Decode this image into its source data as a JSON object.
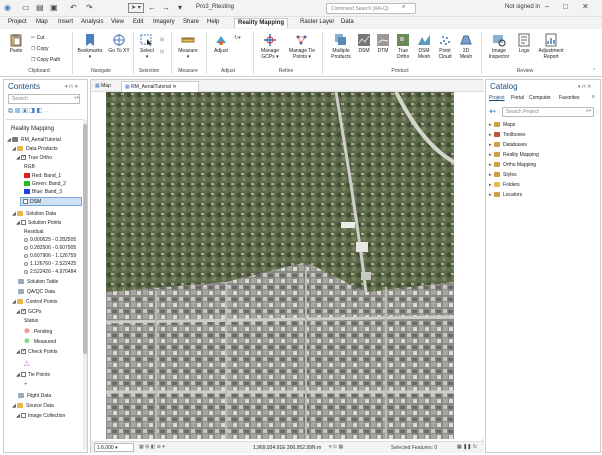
{
  "titlebar": {
    "doc_title": "Pro3_Rtesting",
    "search_placeholder": "Command Search (Alt+Q)",
    "signin": "Not signed in"
  },
  "tabs": {
    "project": "Project",
    "map": "Map",
    "insert": "Insert",
    "analysis": "Analysis",
    "view": "View",
    "edit": "Edit",
    "imagery": "Imagery",
    "share": "Share",
    "help": "Help",
    "reality": "Reality Mapping",
    "raster": "Raster Layer",
    "data": "Data"
  },
  "ribbon": {
    "paste": "Paste",
    "cut": "Cut",
    "copy": "Copy",
    "copy_path": "Copy Path",
    "clipboard": "Clipboard",
    "bookmarks": "Bookmarks",
    "goto": "Go To XY",
    "navigate": "Navigate",
    "select": "Select",
    "selection": "Selection",
    "measure": "Measure",
    "measure_grp": "Measure",
    "adjust": "Adjust",
    "adjust_grp": "Adjust",
    "manage_gcps": "Manage GCPs",
    "manage_tie": "Manage Tie Points",
    "refine": "Refine",
    "multiple": "Multiple Products",
    "dsm": "DSM",
    "dtm": "DTM",
    "true_ortho": "True Ortho",
    "dsm_mesh": "DSM Mesh",
    "point_cloud": "Point Cloud",
    "mesh3d": "3D Mesh",
    "product": "Product",
    "image_inspector": "Image Inspector",
    "logs": "Logs",
    "adj_report": "Adjustment Report",
    "review": "Review"
  },
  "contents": {
    "title": "Contents",
    "search_placeholder": "Search",
    "section": "Reality Mapping",
    "rm": "RM_AerialTutorial",
    "data_products": "Data Products",
    "true_ortho": "True Ortho",
    "rgb": "RGB",
    "red": "Red: Band_1",
    "green": "Green: Band_2",
    "blue": "Blue: Band_3",
    "dsm": "DSM",
    "solution_data": "Solution Data",
    "solution_points": "Solution Points",
    "residual": "Residual",
    "r1": "0.000625 - 0.282505",
    "r2": "0.282506 - 0.607905",
    "r3": "0.607906 - 1.126759",
    "r4": "1.126760 - 2.522425",
    "r5": "2.522426 - 4.970484",
    "solution_table": "Solution Table",
    "qaqc": "QA/QC Data",
    "control_points": "Control Points",
    "gcps": "GCPs",
    "status": "Status",
    "pending": "Pending",
    "measured": "Measured",
    "check_points": "Check Points",
    "tie_points": "Tie Points",
    "flight_data": "Flight Data",
    "source_data": "Source Data",
    "image_collection": "Image Collection"
  },
  "mapview": {
    "tab_map": "Map",
    "tab_rm": "RM_AerialTutorial",
    "scale": "1:6,000",
    "coords": "1,969,934.91E 300,952.99N m",
    "selected": "Selected Features: 0"
  },
  "catalog": {
    "title": "Catalog",
    "tab_project": "Project",
    "tab_portal": "Portal",
    "tab_computer": "Computer",
    "tab_favorites": "Favorites",
    "search_placeholder": "Search Project",
    "items": [
      "Maps",
      "Toolboxes",
      "Databases",
      "Reality Mapping",
      "Ortho Mapping",
      "Styles",
      "Folders",
      "Locators"
    ]
  },
  "colors": {
    "accent": "#1a4a80",
    "red": "#e02020",
    "green": "#20c020",
    "blue": "#2040e0",
    "pending": "#e03030",
    "measured": "#20b020",
    "check": "#e040e0",
    "tie": "#3060d0"
  }
}
